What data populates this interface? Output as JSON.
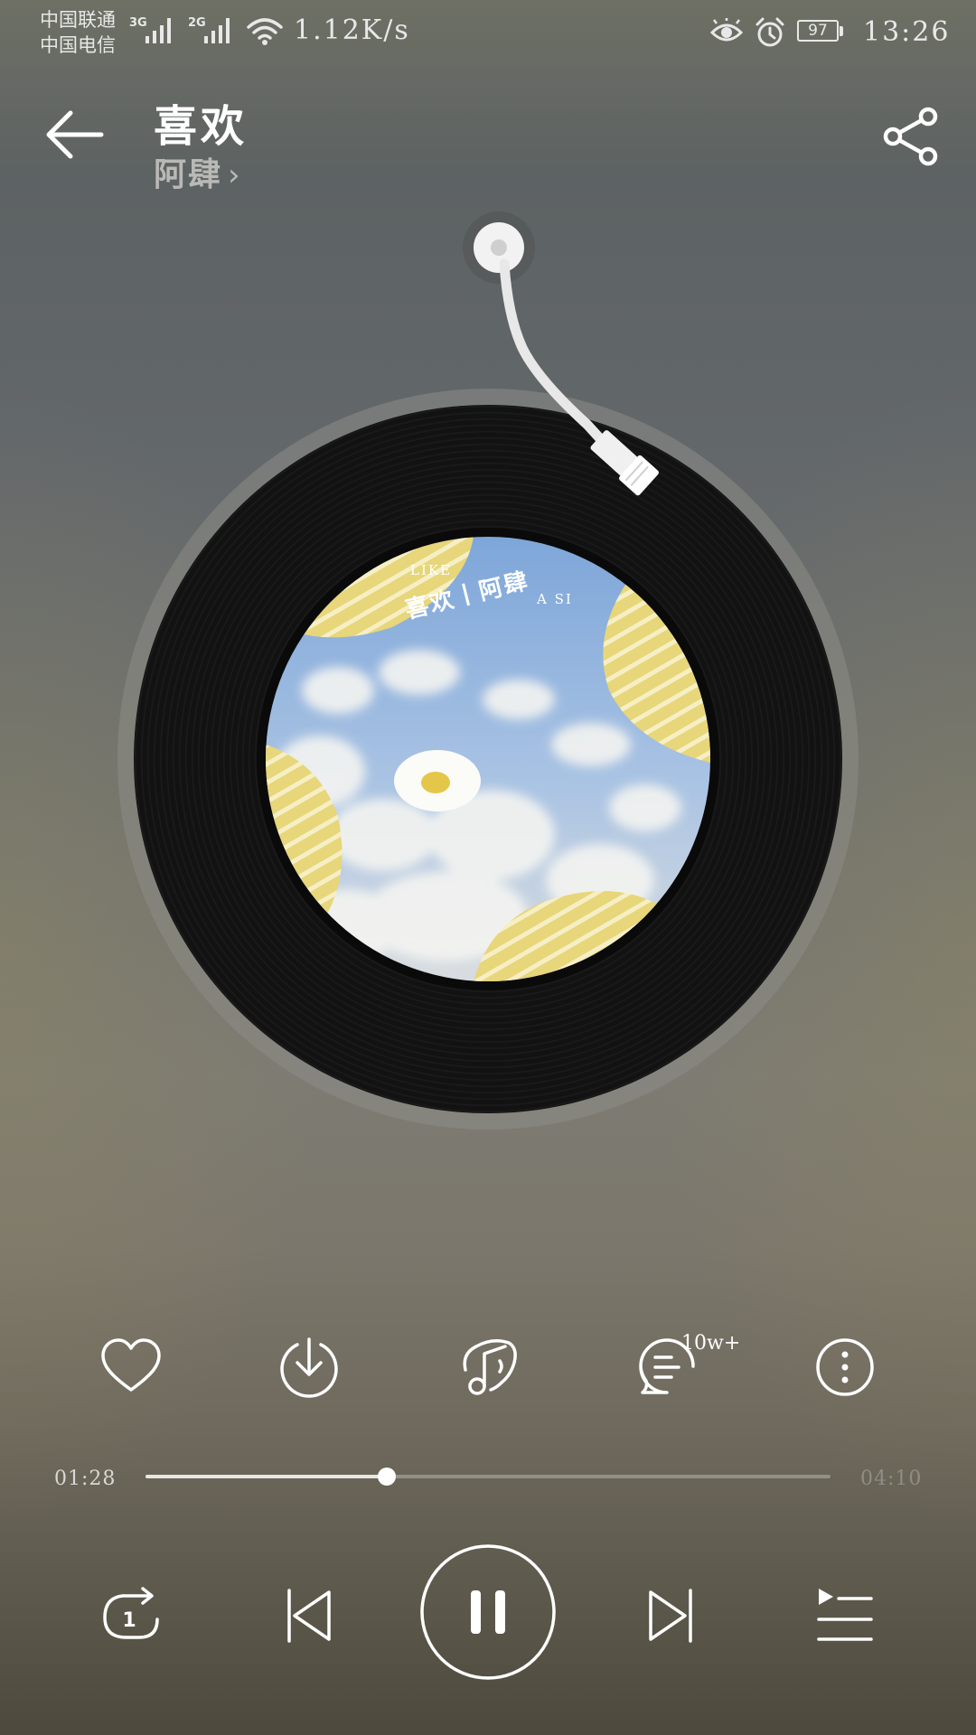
{
  "status_bar": {
    "carrier_1": "中国联通",
    "carrier_2": "中国电信",
    "network_1": "3G",
    "network_2": "2G",
    "speed": "1.12K/s",
    "battery": "97",
    "time": "13:26",
    "icons": [
      "eye-icon",
      "alarm-icon",
      "wifi-icon",
      "signal-icon"
    ]
  },
  "header": {
    "title": "喜欢",
    "artist": "阿肆",
    "artist_chevron": "›"
  },
  "album_art": {
    "line_1_left": "LIKE",
    "line_1_right": "A SI",
    "title": "喜欢丨阿肆"
  },
  "actions": {
    "comment_count": "10w+",
    "icons": [
      "heart-icon",
      "download-icon",
      "music-effect-icon",
      "comment-icon",
      "more-icon"
    ]
  },
  "progress": {
    "current": "01:28",
    "total": "04:10",
    "fraction": 0.352
  },
  "controls": {
    "icons": [
      "repeat-one-icon",
      "previous-icon",
      "pause-icon",
      "next-icon",
      "playlist-icon"
    ]
  },
  "colors": {
    "accent": "#ffffff",
    "cover_yellow": "#e9d877",
    "cover_sky": "#8fb2dd"
  }
}
